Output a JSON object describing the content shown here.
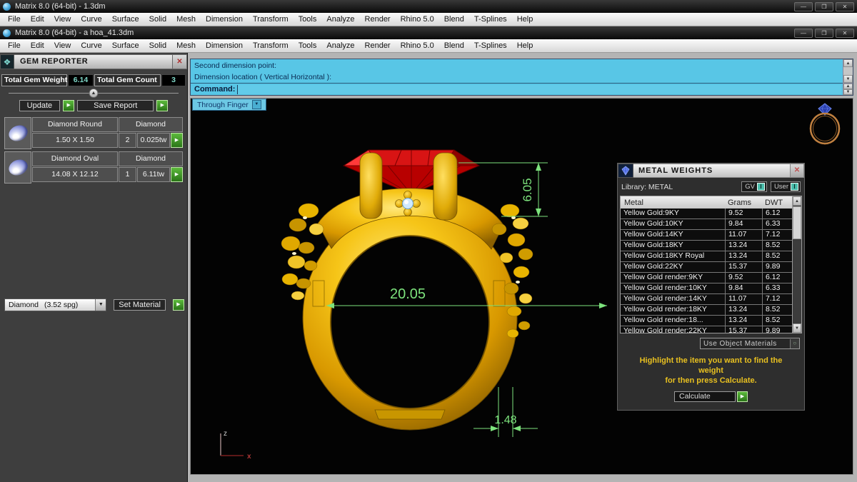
{
  "window1": {
    "title": "Matrix 8.0 (64-bit) - 1.3dm"
  },
  "window2": {
    "title": "Matrix 8.0 (64-bit) - a hoa_41.3dm"
  },
  "menu": [
    "File",
    "Edit",
    "View",
    "Curve",
    "Surface",
    "Solid",
    "Mesh",
    "Dimension",
    "Transform",
    "Tools",
    "Analyze",
    "Render",
    "Rhino 5.0",
    "Blend",
    "T-Splines",
    "Help"
  ],
  "icons": {
    "minimize": "—",
    "restore": "❐",
    "close": "✕",
    "play": "▶",
    "dropdown": "▼",
    "up": "▲",
    "down": "▼",
    "gem": "❖",
    "collapse": "▲",
    "circle": "○",
    "toggle_on": "I"
  },
  "gem_reporter": {
    "title": "GEM REPORTER",
    "total_weight_label": "Total Gem Weight",
    "total_weight_value": "6.14",
    "total_count_label": "Total Gem Count",
    "total_count_value": "3",
    "update_label": "Update",
    "save_report_label": "Save Report",
    "gems": [
      {
        "name": "Diamond Round",
        "size": "1.50 X 1.50",
        "material": "Diamond",
        "count": "2",
        "weight": "0.025tw"
      },
      {
        "name": "Diamond Oval",
        "size": "14.08 X 12.12",
        "material": "Diamond",
        "count": "1",
        "weight": "6.11tw"
      }
    ],
    "material_select_name": "Diamond",
    "material_select_spg": "(3.52 spg)",
    "set_material_label": "Set Material"
  },
  "command_panel": {
    "history_line1": "Second dimension point:",
    "history_line2": "Dimension location ( Vertical  Horizontal ):",
    "prompt_label": "Command:"
  },
  "viewport": {
    "tab_label": "Through Finger",
    "dim_height": "6.05",
    "dim_diameter": "20.05",
    "dim_thickness": "1.48",
    "axis_x": "x",
    "axis_z": "z"
  },
  "metal_weights": {
    "title": "METAL WEIGHTS",
    "library_label": "Library: METAL",
    "gv_label": "GV",
    "user_label": "User",
    "columns": [
      "Metal",
      "Grams",
      "DWT"
    ],
    "rows": [
      [
        "Yellow Gold:9KY",
        "9.52",
        "6.12"
      ],
      [
        "Yellow Gold:10KY",
        "9.84",
        "6.33"
      ],
      [
        "Yellow Gold:14KY",
        "11.07",
        "7.12"
      ],
      [
        "Yellow Gold:18KY",
        "13.24",
        "8.52"
      ],
      [
        "Yellow Gold:18KY Royal",
        "13.24",
        "8.52"
      ],
      [
        "Yellow Gold:22KY",
        "15.37",
        "9.89"
      ],
      [
        "Yellow Gold render:9KY",
        "9.52",
        "6.12"
      ],
      [
        "Yellow Gold render:10KY",
        "9.84",
        "6.33"
      ],
      [
        "Yellow Gold render:14KY",
        "11.07",
        "7.12"
      ],
      [
        "Yellow Gold render:18KY",
        "13.24",
        "8.52"
      ],
      [
        "Yellow Gold render:18...",
        "13.24",
        "8.52"
      ],
      [
        "Yellow Gold render:22KY",
        "15.37",
        "9.89"
      ]
    ],
    "use_object_materials": "Use Object Materials",
    "instruction_line1": "Highlight the item you want to find the weight",
    "instruction_line2": "for then press Calculate.",
    "calculate_label": "Calculate"
  },
  "colors": {
    "accent_green": "#3a9a28",
    "dimension_green": "#7de37d",
    "command_cyan": "#58c6e6",
    "gold": "#f0b400",
    "gem_red": "#d40000",
    "value_teal": "#7fd8c8",
    "warning_yellow": "#e8c020"
  }
}
